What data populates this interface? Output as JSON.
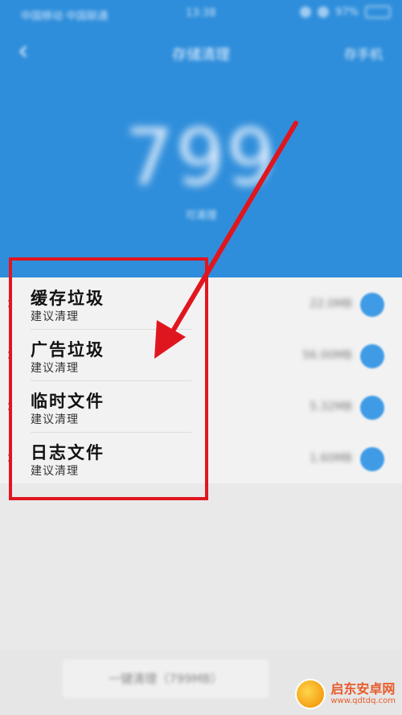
{
  "status": {
    "carrier": "中国移动 中国联通",
    "time": "13:38",
    "battery": "97%"
  },
  "nav": {
    "back_icon": "‹",
    "title": "存储清理",
    "right_label": "存手机"
  },
  "summary": {
    "value": "799",
    "unit": "可清理"
  },
  "items": [
    {
      "title": "缓存垃圾",
      "subtitle": "建议清理",
      "size": "22.0MB"
    },
    {
      "title": "广告垃圾",
      "subtitle": "建议清理",
      "size": "56.00MB"
    },
    {
      "title": "临时文件",
      "subtitle": "建议清理",
      "size": "5.32MB"
    },
    {
      "title": "日志文件",
      "subtitle": "建议清理",
      "size": "1.60MB"
    }
  ],
  "bottom": {
    "clean_label": "一键清理（799MB）"
  },
  "watermark": {
    "cn": "启东安卓网",
    "url": "www.qdtdq.com"
  },
  "colors": {
    "header_blue": "#2f8edb",
    "annotation_red": "#e0161f",
    "check_blue": "#3f9be6"
  }
}
